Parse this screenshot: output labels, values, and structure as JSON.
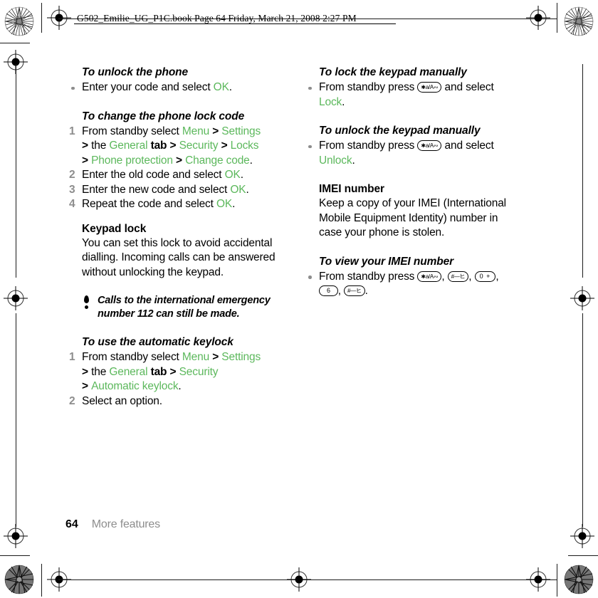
{
  "header": {
    "text": "G502_Emilie_UG_P1C.book  Page 64  Friday, March 21, 2008  2:27 PM"
  },
  "colors": {
    "ui_term_green": "#5cb85c",
    "marker_gray": "#8d8d8d",
    "text_black": "#000000"
  },
  "left_column": {
    "unlock_phone": {
      "heading": "To unlock the phone",
      "bullet_1": {
        "pre": "Enter your code and select ",
        "ui": "OK",
        "post": "."
      }
    },
    "change_lock_code": {
      "heading": "To change the phone lock code",
      "step_1": {
        "n": "1",
        "t1": "From standby select ",
        "u1": "Menu",
        "g1": " > ",
        "u2": "Settings",
        "g2": " > ",
        "t2": "the ",
        "u3": "General",
        "t3": " tab",
        "g3": " > ",
        "u4": "Security",
        "g4": " > ",
        "u5": "Locks",
        "g5": " > ",
        "u6": "Phone protection",
        "g6": " > ",
        "u7": "Change code",
        "t4": "."
      },
      "step_2": {
        "n": "2",
        "pre": "Enter the old code and select ",
        "ui": "OK",
        "post": "."
      },
      "step_3": {
        "n": "3",
        "pre": "Enter the new code and select ",
        "ui": "OK",
        "post": "."
      },
      "step_4": {
        "n": "4",
        "pre": "Repeat the code and select ",
        "ui": "OK",
        "post": "."
      }
    },
    "keypad_lock": {
      "heading": "Keypad lock",
      "body": "You can set this lock to avoid accidental dialling. Incoming calls can be answered without unlocking the keypad."
    },
    "note": {
      "icon": "exclamation-icon",
      "text": "Calls to the international emergency number 112 can still be made."
    },
    "automatic_keylock": {
      "heading": "To use the automatic keylock",
      "step_1": {
        "n": "1",
        "t1": "From standby select ",
        "u1": "Menu",
        "g1": " > ",
        "u2": "Settings",
        "g2": " > ",
        "t2": "the ",
        "u3": "General",
        "t3": " tab",
        "g3": " > ",
        "u4": "Security",
        "g4": " > ",
        "u5": "Automatic keylock",
        "t4": "."
      },
      "step_2": {
        "n": "2",
        "text": "Select an option."
      }
    }
  },
  "right_column": {
    "lock_keypad_manually": {
      "heading": "To lock the keypad manually",
      "bullet_1": {
        "pre": "From standby press ",
        "key": "*a/A",
        "mid": " and select ",
        "ui": "Lock",
        "post": "."
      }
    },
    "unlock_keypad_manually": {
      "heading": "To unlock the keypad manually",
      "bullet_1": {
        "pre": "From standby press ",
        "key": "*a/A",
        "mid": " and select ",
        "ui": "Unlock",
        "post": "."
      }
    },
    "imei": {
      "heading": "IMEI number",
      "body": "Keep a copy of your IMEI (International Mobile Equipment Identity) number in case your phone is stolen."
    },
    "view_imei": {
      "heading": "To view your IMEI number",
      "bullet_1": {
        "pre": "From standby press ",
        "keys": [
          "*a/A",
          "#",
          "0 +",
          "6",
          "#"
        ],
        "sep": ", ",
        "post": "."
      }
    }
  },
  "footer": {
    "page_number": "64",
    "section": "More features"
  }
}
